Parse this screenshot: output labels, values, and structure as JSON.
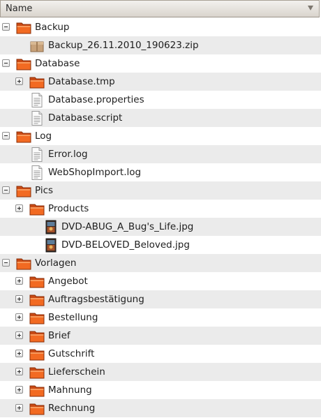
{
  "header": {
    "title": "Name"
  },
  "rows": [
    {
      "label": "Backup",
      "type": "folder",
      "expander": "minus"
    },
    {
      "label": "Backup_26.11.2010_190623.zip",
      "type": "zip",
      "expander": "none"
    },
    {
      "label": "Database",
      "type": "folder",
      "expander": "minus"
    },
    {
      "label": "Database.tmp",
      "type": "folder",
      "expander": "plus"
    },
    {
      "label": "Database.properties",
      "type": "text-file",
      "expander": "none"
    },
    {
      "label": "Database.script",
      "type": "text-file",
      "expander": "none"
    },
    {
      "label": "Log",
      "type": "folder",
      "expander": "minus"
    },
    {
      "label": "Error.log",
      "type": "text-file",
      "expander": "none"
    },
    {
      "label": "WebShopImport.log",
      "type": "text-file",
      "expander": "none"
    },
    {
      "label": "Pics",
      "type": "folder",
      "expander": "minus"
    },
    {
      "label": "Products",
      "type": "folder",
      "expander": "plus"
    },
    {
      "label": "DVD-ABUG_A_Bug's_Life.jpg",
      "type": "image-thumb",
      "expander": "none"
    },
    {
      "label": "DVD-BELOVED_Beloved.jpg",
      "type": "image-thumb",
      "expander": "none"
    },
    {
      "label": "Vorlagen",
      "type": "folder",
      "expander": "minus"
    },
    {
      "label": "Angebot",
      "type": "folder",
      "expander": "plus"
    },
    {
      "label": "Auftragsbestätigung",
      "type": "folder",
      "expander": "plus"
    },
    {
      "label": "Bestellung",
      "type": "folder",
      "expander": "plus"
    },
    {
      "label": "Brief",
      "type": "folder",
      "expander": "plus"
    },
    {
      "label": "Gutschrift",
      "type": "folder",
      "expander": "plus"
    },
    {
      "label": "Lieferschein",
      "type": "folder",
      "expander": "plus"
    },
    {
      "label": "Mahnung",
      "type": "folder",
      "expander": "plus"
    },
    {
      "label": "Rechnung",
      "type": "folder",
      "expander": "plus"
    }
  ]
}
